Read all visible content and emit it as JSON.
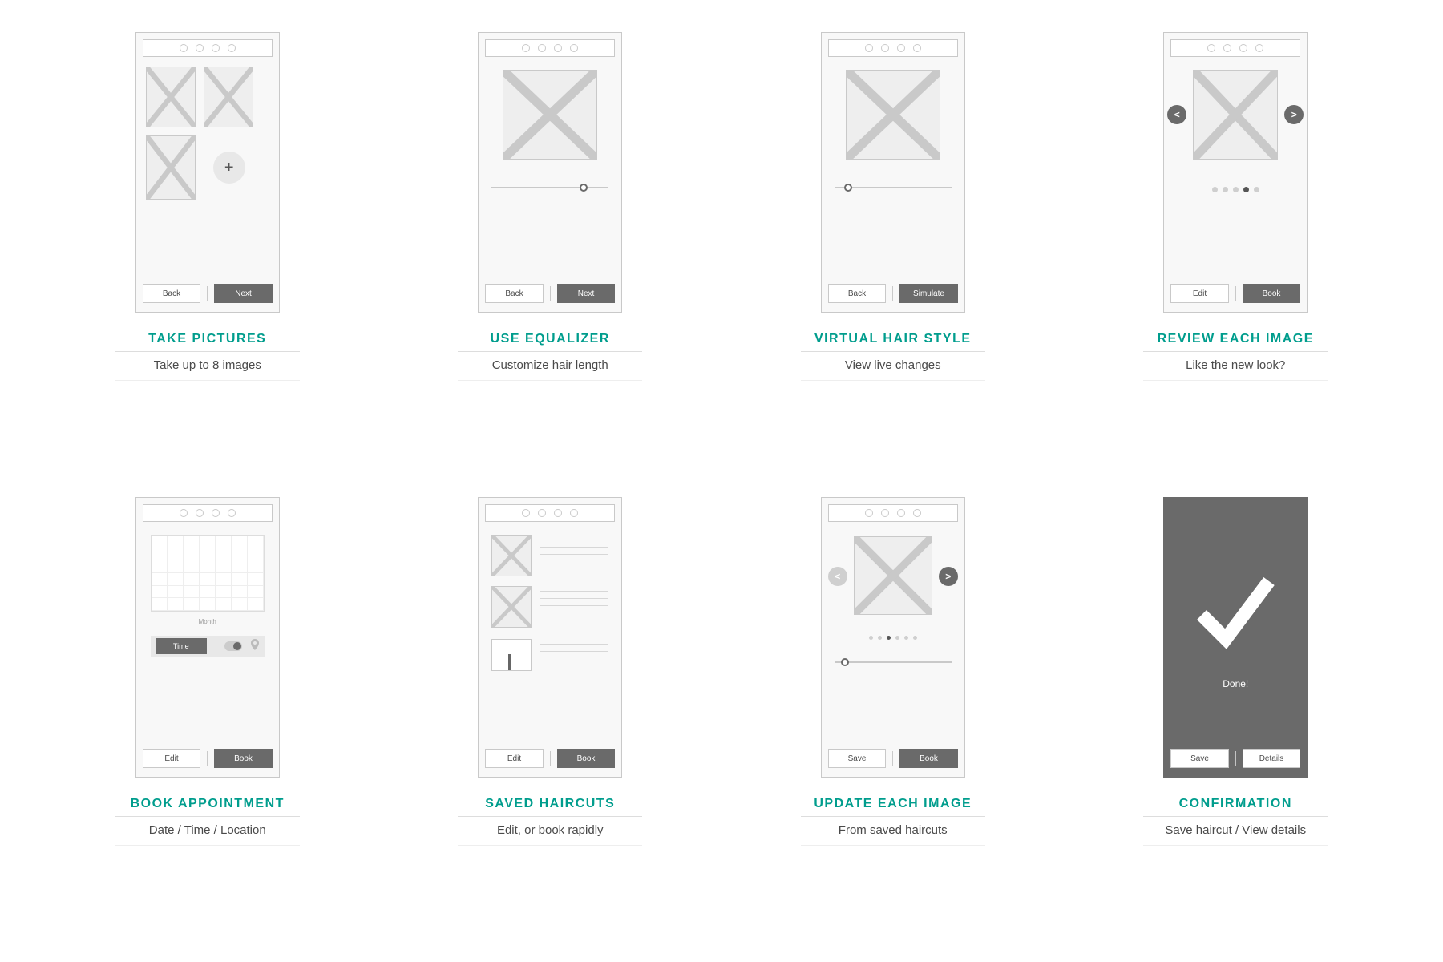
{
  "screens": [
    {
      "id": "take-pictures",
      "title": "TAKE PICTURES",
      "subtitle": "Take up to 8 images",
      "back": "Back",
      "primary": "Next"
    },
    {
      "id": "use-equalizer",
      "title": "USE EQUALIZER",
      "subtitle": "Customize hair length",
      "back": "Back",
      "primary": "Next"
    },
    {
      "id": "virtual-hair-style",
      "title": "VIRTUAL HAIR STYLE",
      "subtitle": "View live changes",
      "back": "Back",
      "primary": "Simulate"
    },
    {
      "id": "review-each-image",
      "title": "REVIEW EACH IMAGE",
      "subtitle": "Like the new look?",
      "back": "Edit",
      "primary": "Book",
      "pager_active": 3,
      "pager_count": 5
    },
    {
      "id": "book-appointment",
      "title": "BOOK APPOINTMENT",
      "subtitle": "Date / Time / Location",
      "back": "Edit",
      "primary": "Book",
      "month_label": "Month",
      "time_button": "Time"
    },
    {
      "id": "saved-haircuts",
      "title": "SAVED HAIRCUTS",
      "subtitle": "Edit, or book rapidly",
      "back": "Edit",
      "primary": "Book"
    },
    {
      "id": "update-each-image",
      "title": "UPDATE EACH IMAGE",
      "subtitle": "From saved haircuts",
      "back": "Save",
      "primary": "Book",
      "pager_active": 2,
      "pager_count": 6
    },
    {
      "id": "confirmation",
      "title": "CONFIRMATION",
      "subtitle": "Save haircut / View details",
      "back": "Save",
      "primary": "Details",
      "done": "Done!"
    }
  ]
}
